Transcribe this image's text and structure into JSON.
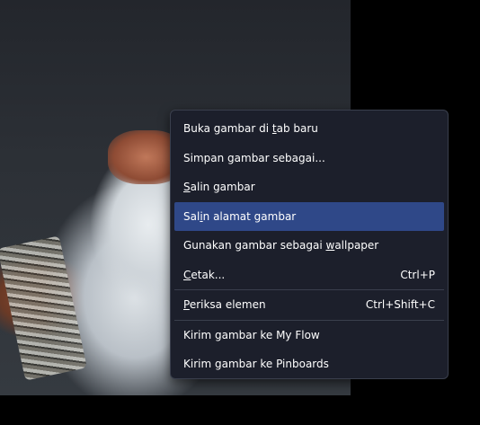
{
  "context_menu": {
    "items": [
      {
        "pre": "Buka gambar di ",
        "acc": "t",
        "post": "ab baru",
        "shortcut": ""
      },
      {
        "pre": "Simpan gambar sebagai...",
        "acc": "",
        "post": "",
        "shortcut": ""
      },
      {
        "pre": "",
        "acc": "S",
        "post": "alin gambar",
        "shortcut": ""
      },
      {
        "pre": "Sal",
        "acc": "i",
        "post": "n alamat gambar",
        "shortcut": ""
      },
      {
        "pre": "Gunakan gambar sebagai ",
        "acc": "w",
        "post": "allpaper",
        "shortcut": ""
      },
      {
        "pre": "",
        "acc": "C",
        "post": "etak...",
        "shortcut": "Ctrl+P"
      },
      {
        "pre": "",
        "acc": "P",
        "post": "eriksa elemen",
        "shortcut": "Ctrl+Shift+C"
      },
      {
        "pre": "Kirim gambar ke My Flow",
        "acc": "",
        "post": "",
        "shortcut": ""
      },
      {
        "pre": "Kirim gambar ke Pinboards",
        "acc": "",
        "post": "",
        "shortcut": ""
      }
    ]
  },
  "colors": {
    "menu_bg": "#1c1f2b",
    "highlight": "#2f4888",
    "separator": "#3a3f4d"
  }
}
